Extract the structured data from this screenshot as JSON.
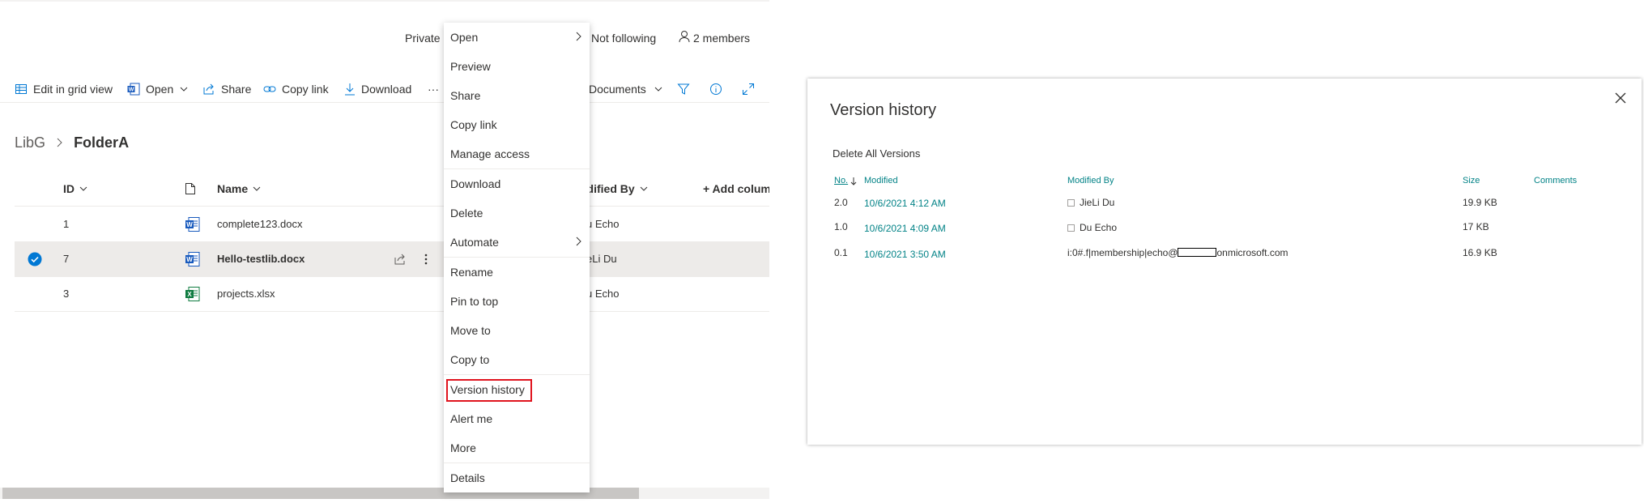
{
  "header": {
    "privacy_text": "Private",
    "following_text": "Not following",
    "members_text": "2 members"
  },
  "commandbar": {
    "edit_grid_label": "Edit in grid view",
    "open_label": "Open",
    "share_label": "Share",
    "copy_link_label": "Copy link",
    "download_label": "Download",
    "overflow_label": "···",
    "view_label": "Documents"
  },
  "breadcrumb": {
    "parent": "LibG",
    "current": "FolderA"
  },
  "columns": {
    "id": "ID",
    "name": "Name",
    "modified_by": "odified By",
    "add_column": "+ Add colum"
  },
  "rows": [
    {
      "id": "1",
      "name": "complete123.docx",
      "modified_by": "u Echo"
    },
    {
      "id": "7",
      "name": "Hello-testlib.docx",
      "modified_by": "eLi Du"
    },
    {
      "id": "3",
      "name": "projects.xlsx",
      "modified_by": "u Echo"
    }
  ],
  "context_menu": {
    "items": [
      "Open",
      "Preview",
      "Share",
      "Copy link",
      "Manage access",
      "Download",
      "Delete",
      "Automate",
      "Rename",
      "Pin to top",
      "Move to",
      "Copy to",
      "Version history",
      "Alert me",
      "More",
      "Details"
    ],
    "highlighted_item": "Version history"
  },
  "version_history": {
    "title": "Version history",
    "delete_all_label": "Delete All Versions",
    "headers": {
      "no": "No.",
      "modified": "Modified",
      "modified_by": "Modified By",
      "size": "Size",
      "comments": "Comments"
    },
    "versions": [
      {
        "no": "2.0",
        "modified": "10/6/2021 4:12 AM",
        "modified_by": "JieLi Du",
        "size": "19.9 KB"
      },
      {
        "no": "1.0",
        "modified": "10/6/2021 4:09 AM",
        "modified_by": "Du Echo",
        "size": "17 KB"
      },
      {
        "no": "0.1",
        "modified": "10/6/2021 3:50 AM",
        "modified_by_prefix": "i:0#.f|membership|echo@",
        "modified_by_suffix": "onmicrosoft.com",
        "size": "16.9 KB"
      }
    ]
  },
  "colors": {
    "teal": "#038387",
    "highlight_red": "#e0141e",
    "selected_check": "#0078d4",
    "word_blue": "#185abd",
    "excel_green": "#107c41"
  }
}
